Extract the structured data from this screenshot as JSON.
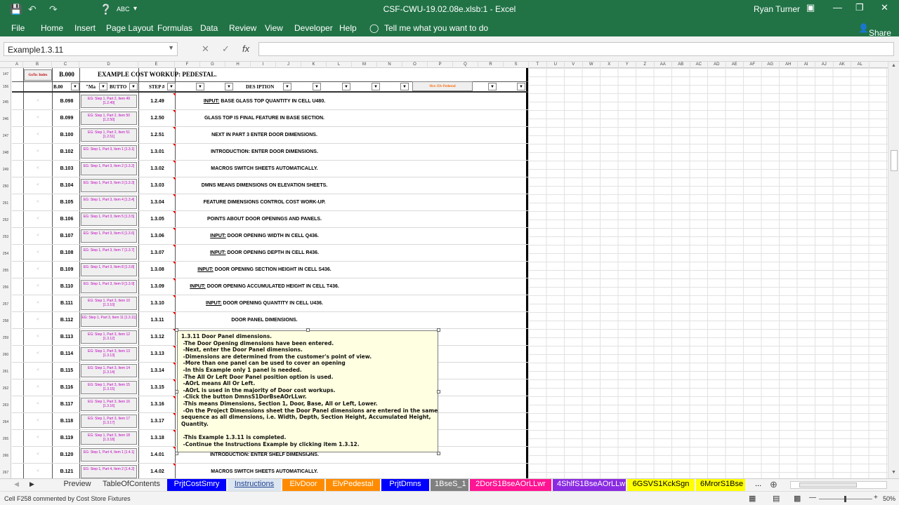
{
  "app": {
    "title": "CSF-CWU-19.02.08e.xlsb:1  -  Excel",
    "user": "Ryan Turner",
    "share": "Share",
    "tell_me": "Tell me what you want to do",
    "menus": [
      "File",
      "Home",
      "Insert",
      "Page Layout",
      "Formulas",
      "Data",
      "Review",
      "View",
      "Developer",
      "Help"
    ]
  },
  "formula_bar": {
    "name_box": "Example1.3.11",
    "fx": "fx",
    "value": ""
  },
  "columns": [
    "A",
    "B",
    "C",
    "D",
    "E",
    "F",
    "G",
    "H",
    "I",
    "J",
    "K",
    "L",
    "M",
    "N",
    "O",
    "P",
    "Q",
    "R",
    "S",
    "T",
    "U",
    "V",
    "W",
    "X",
    "Y",
    "Z",
    "AA",
    "AB",
    "AC",
    "AD",
    "AE",
    "AF",
    "AG",
    "AH",
    "AI",
    "AJ",
    "AK",
    "AL"
  ],
  "header_rows": {
    "row_numbers": [
      "147",
      "156"
    ],
    "goto": "GoTo: Index",
    "code_top": "B.000",
    "title": "EXAMPLE COST WORKUP:  PEDESTAL.",
    "f_code": "B.00",
    "f_macro": "\"Ma",
    "f_button": "BUTTO",
    "f_step": "STEP #",
    "f_desc": "DES    IPTION",
    "sel_button": "Slct: Elv Pedestal"
  },
  "rows": [
    {
      "n": "245",
      "code": "B.098",
      "btn": "EG: Step 1, Part 2, Item 49 [1.2.49]",
      "step": "1.2.49",
      "input": "INPUT:",
      "desc": " BASE GLASS TOP QUANTITY IN CELL U480."
    },
    {
      "n": "246",
      "code": "B.099",
      "btn": "EG: Step 1, Part 2, Item 50 [1.2.50]",
      "step": "1.2.50",
      "input": "",
      "desc": "GLASS TOP IS FINAL FEATURE IN BASE SECTION."
    },
    {
      "n": "247",
      "code": "B.100",
      "btn": "EG: Step 1, Part 2, Item 51 [1.2.51]",
      "step": "1.2.51",
      "input": "",
      "desc": "NEXT IN PART 3 ENTER DOOR DIMENSIONS."
    },
    {
      "n": "248",
      "code": "B.102",
      "btn": "EG: Step 1, Part 3, Item 1 [1.3.1]",
      "step": "1.3.01",
      "input": "",
      "desc": "INTRODUCTION: ENTER DOOR DIMENSIONS."
    },
    {
      "n": "249",
      "code": "B.103",
      "btn": "EG: Step 1, Part 3, Item 2 [1.3.2]",
      "step": "1.3.02",
      "input": "",
      "desc": "MACROS SWITCH SHEETS AUTOMATICALLY."
    },
    {
      "n": "250",
      "code": "B.104",
      "btn": "EG: Step 1, Part 3, Item 3 [1.3.3]",
      "step": "1.3.03",
      "input": "",
      "desc": "DMNS MEANS DIMENSIONS ON ELEVATION SHEETS."
    },
    {
      "n": "251",
      "code": "B.105",
      "btn": "EG: Step 1, Part 3, Item 4 [1.3.4]",
      "step": "1.3.04",
      "input": "",
      "desc": "FEATURE DIMENSIONS CONTROL COST WORK-UP."
    },
    {
      "n": "252",
      "code": "B.106",
      "btn": "EG: Step 1, Part 3, Item 5 [1.3.5]",
      "step": "1.3.05",
      "input": "",
      "desc": "POINTS ABOUT DOOR OPENINGS AND PANELS."
    },
    {
      "n": "253",
      "code": "B.107",
      "btn": "EG: Step 1, Part 3, Item 6 [1.3.6]",
      "step": "1.3.06",
      "input": "INPUT:",
      "desc": " DOOR OPENING WIDTH IN CELL Q436."
    },
    {
      "n": "254",
      "code": "B.108",
      "btn": "EG: Step 1, Part 3, Item 7 [1.3.7]",
      "step": "1.3.07",
      "input": "INPUT:",
      "desc": " DOOR OPENING DEPTH IN CELL R436."
    },
    {
      "n": "255",
      "code": "B.109",
      "btn": "EG: Step 1, Part 3, Item 8 [1.3.8]",
      "step": "1.3.08",
      "input": "INPUT:",
      "desc": " DOOR OPENING SECTION HEIGHT IN CELL S436."
    },
    {
      "n": "256",
      "code": "B.110",
      "btn": "EG: Step 1, Part 3, Item 9 [1.3.9]",
      "step": "1.3.09",
      "input": "INPUT:",
      "desc": " DOOR OPENING ACCUMULATED HEIGHT IN CELL T436."
    },
    {
      "n": "257",
      "code": "B.111",
      "btn": "EG: Step 1, Part 3, Item 10 [1.3.10]",
      "step": "1.3.10",
      "input": "INPUT:",
      "desc": " DOOR OPENING QUANTITY IN CELL U436."
    },
    {
      "n": "258",
      "code": "B.112",
      "btn": "EG: Step 1, Part 3, Item 11 [1.3.11]",
      "step": "1.3.11",
      "input": "",
      "desc": "DOOR PANEL DIMENSIONS."
    },
    {
      "n": "259",
      "code": "B.113",
      "btn": "EG: Step 1, Part 3, Item 12 [1.3.12]",
      "step": "1.3.12",
      "input": "",
      "desc": ""
    },
    {
      "n": "260",
      "code": "B.114",
      "btn": "EG: Step 1, Part 3, Item 13 [1.3.13]",
      "step": "1.3.13",
      "input": "",
      "desc": ""
    },
    {
      "n": "261",
      "code": "B.115",
      "btn": "EG: Step 1, Part 3, Item 14 [1.3.14]",
      "step": "1.3.14",
      "input": "",
      "desc": ""
    },
    {
      "n": "262",
      "code": "B.116",
      "btn": "EG: Step 1, Part 3, Item 15 [1.3.15]",
      "step": "1.3.15",
      "input": "",
      "desc": ""
    },
    {
      "n": "263",
      "code": "B.117",
      "btn": "EG: Step 1, Part 3, Item 16 [1.3.16]",
      "step": "1.3.16",
      "input": "",
      "desc": ""
    },
    {
      "n": "264",
      "code": "B.118",
      "btn": "EG: Step 1, Part 3, Item 17 [1.3.17]",
      "step": "1.3.17",
      "input": "",
      "desc": ""
    },
    {
      "n": "265",
      "code": "B.119",
      "btn": "EG: Step 1, Part 3, Item 18 [1.3.18]",
      "step": "1.3.18",
      "input": "",
      "desc": ""
    },
    {
      "n": "266",
      "code": "B.120",
      "btn": "EG: Step 1, Part 4, Item 1 [1.4.1]",
      "step": "1.4.01",
      "input": "",
      "desc": "INTRODUCTION: ENTER SHELF DIMENSIONS."
    },
    {
      "n": "267",
      "code": "B.121",
      "btn": "EG: Step 1, Part 4, Item 2 [1.4.2]",
      "step": "1.4.02",
      "input": "",
      "desc": "MACROS SWITCH SHEETS AUTOMATICALLY."
    }
  ],
  "comment": {
    "lines": [
      "1.3.11 Door Panel dimensions.",
      " -The Door Opening dimensions have been entered.",
      " -Next, enter the Door Panel dimensions.",
      " -Dimensions are determined from the customer's point of view.",
      " -More than one panel can be used to cover an opening",
      " -In this Example only 1 panel is needed.",
      " -The All Or Left Door Panel position option is used.",
      " -AOrL means All Or Left.",
      " -AOrL is used in the majority of Door cost workups.",
      " -Click the button DmnsS1DorBseAOrLLwr.",
      " -This means Dimensions, Section 1, Door, Base, All or Left, Lower.",
      " -On the Project Dimensions sheet the Door Panel dimensions are entered in the same",
      "sequence as all dimensions, i.e. Width, Depth, Section Height, Accumulated Height,",
      "Quantity.",
      "",
      " -This Example 1.3.11 is completed.",
      " -Continue the Instructions Example by clicking item 1.3.12."
    ]
  },
  "tabs": [
    {
      "label": "Preview",
      "bg": "#f3f3f3",
      "fg": "#333"
    },
    {
      "label": "TableOfContents",
      "bg": "#f3f3f3",
      "fg": "#333"
    },
    {
      "label": "PrjtCostSmry",
      "bg": "#0000ff",
      "fg": "#ffffff"
    },
    {
      "label": "Instructions",
      "bg": "#dce6f1",
      "fg": "#1f3f8f"
    },
    {
      "label": "ElvDoor",
      "bg": "#ff8c00",
      "fg": "#ffffff"
    },
    {
      "label": "ElvPedestal",
      "bg": "#ff8c00",
      "fg": "#ffffff"
    },
    {
      "label": "PrjtDmns",
      "bg": "#0000ff",
      "fg": "#ffffff"
    },
    {
      "label": "1BseS_1",
      "bg": "#808080",
      "fg": "#ffffff"
    },
    {
      "label": "2DorS1BseAOrLLwr",
      "bg": "#ff1493",
      "fg": "#ffffff"
    },
    {
      "label": "4ShlfS1BseAOrLLwr",
      "bg": "#8a2be2",
      "fg": "#ffffff"
    },
    {
      "label": "6GSVS1KckSgn",
      "bg": "#ffff00",
      "fg": "#000000"
    },
    {
      "label": "6MrorS1Bse",
      "bg": "#ffff00",
      "fg": "#000000"
    }
  ],
  "tab_more": "...",
  "status": {
    "text": "Cell F258 commented by Cost Store Fixtures",
    "zoom": "50%"
  }
}
